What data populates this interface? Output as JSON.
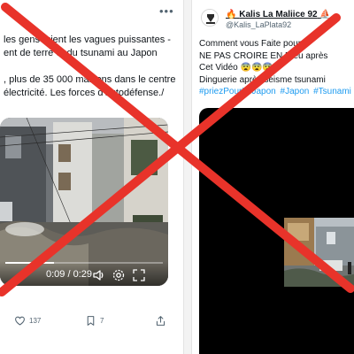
{
  "left_tweet": {
    "text_lines": [
      "les gens fuient les vagues puissantes -",
      "ent de terre et du tsunami au Japon",
      "",
      ", plus de 35 000 maisons dans le centre",
      "électricité. Les forces d'autodéfense./"
    ],
    "video": {
      "elapsed": "0:09",
      "duration": "0:29",
      "time_label": "0:09 / 0:29",
      "progress": 0.31
    },
    "actions": {
      "likes": "137",
      "bookmarks": "7"
    }
  },
  "right_tweet": {
    "display_name": "Kalis La Maliice 92",
    "handle": "@Kalis_LaPlata92",
    "text_lines": [
      "Comment vous Faite pour",
      "NE PAS CROIRE EN Dieu après",
      "Cet Vidéo 😨😨😨",
      "Dinguerie après séisme tsunami"
    ],
    "hashtags": [
      "#priezPourLeJapon",
      "#Japon",
      "#Tsunami"
    ]
  },
  "overlay": {
    "cross_color": "#e8332a"
  },
  "icons": [
    "more-icon",
    "volume-icon",
    "settings-icon",
    "fullscreen-icon",
    "heart-icon",
    "bookmark-icon",
    "share-icon",
    "flame-icon",
    "sailboat-icon"
  ]
}
